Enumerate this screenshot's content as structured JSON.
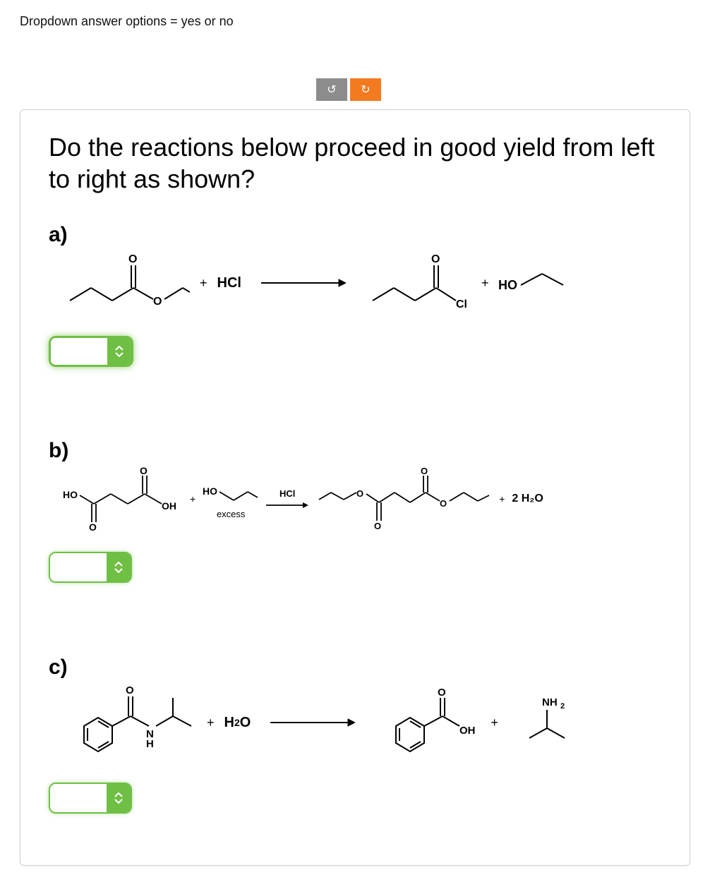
{
  "instruction": "Dropdown answer options  =  yes or no",
  "toolbar": {
    "undo_glyph": "↺",
    "redo_glyph": "↻"
  },
  "question": "Do the reactions below proceed in good yield from left to right as shown?",
  "parts": {
    "a": {
      "label": "a)",
      "reagents": {
        "hcl": "HCl"
      },
      "products": {
        "cl": "Cl",
        "ho": "HO"
      },
      "plus": "+",
      "dropdown_value": ""
    },
    "b": {
      "label": "b)",
      "labels": {
        "ho_left": "HO",
        "oh": "OH",
        "ho_right": "HO",
        "excess": "excess",
        "hcl": "HCl",
        "water2": "2 H₂O",
        "o": "O"
      },
      "plus": "+",
      "dropdown_value": ""
    },
    "c": {
      "label": "c)",
      "labels": {
        "nh": "N",
        "h": "H",
        "h2o": "H₂O",
        "oh": "OH",
        "nh2": "NH₂"
      },
      "plus": "+",
      "dropdown_value": ""
    }
  },
  "dropdown_options": [
    "yes",
    "no"
  ]
}
